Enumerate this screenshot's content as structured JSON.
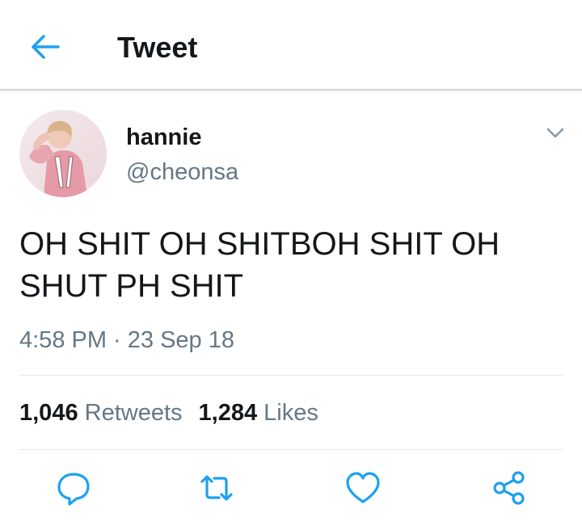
{
  "header": {
    "title": "Tweet"
  },
  "tweet": {
    "name": "hannie",
    "handle": "@cheonsa",
    "text_line1": "OH SHIT OH SHITBOH SHIT OH",
    "text_line2": "SHUT PH SHIT",
    "timestamp": "4:58 PM · 23 Sep 18"
  },
  "stats": {
    "retweets_count": "1,046",
    "retweets_label": "Retweets",
    "likes_count": "1,284",
    "likes_label": "Likes"
  },
  "icons": {
    "back": "arrow-left-icon",
    "caret": "chevron-down-icon",
    "reply": "reply-icon",
    "retweet": "retweet-icon",
    "like": "heart-icon",
    "share": "share-icon"
  },
  "colors": {
    "accent": "#1da1f2",
    "text": "#14171a",
    "secondary": "#657786",
    "divider": "#e1e8ed"
  }
}
